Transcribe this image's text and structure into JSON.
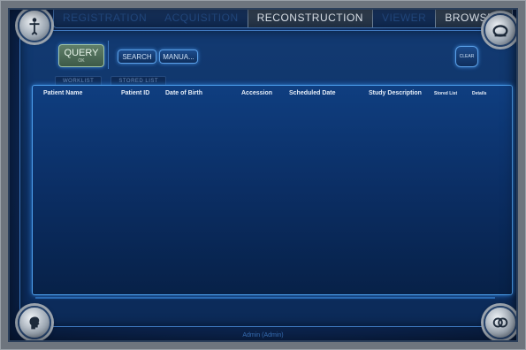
{
  "nav": {
    "tabs": [
      {
        "label": "REGISTRATION"
      },
      {
        "label": "ACQUISITION"
      },
      {
        "label": "RECONSTRUCTION"
      },
      {
        "label": "VIEWER"
      },
      {
        "label": "BROWSER"
      }
    ]
  },
  "toolbar": {
    "query_label": "QUERY",
    "query_sub": "OK",
    "search_label": "SEARCH",
    "manual_label": "MANUA...",
    "clear_label": "CLEAR"
  },
  "subtabs": [
    {
      "label": "WORKLIST"
    },
    {
      "label": "STORED LIST"
    }
  ],
  "table": {
    "headers": [
      {
        "label": "Patient Name"
      },
      {
        "label": "Patient ID"
      },
      {
        "label": "Date of Birth"
      },
      {
        "label": "Accession"
      },
      {
        "label": "Scheduled Date"
      },
      {
        "label": "Study Description"
      },
      {
        "label": "Stored List"
      },
      {
        "label": "Details"
      }
    ],
    "rows": []
  },
  "status": {
    "user": "Admin (Admin)"
  },
  "icons": {
    "top_left": "patient-figure-icon",
    "top_right": "eject-icon",
    "bottom_left": "head-profile-icon",
    "bottom_right": "link-icon"
  }
}
